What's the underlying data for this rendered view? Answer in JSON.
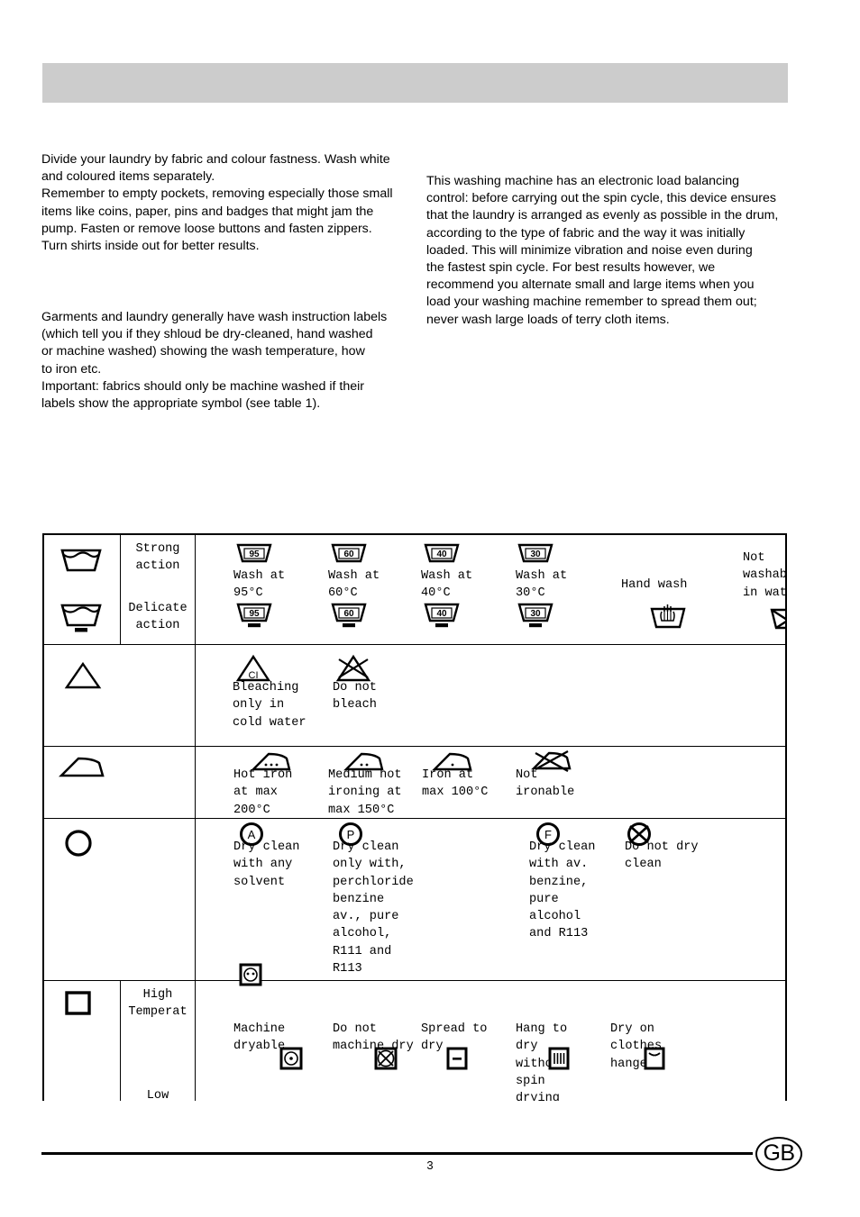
{
  "document": {
    "page_number": "3",
    "locale_badge": "GB"
  },
  "intro": {
    "left_block_1": [
      "Divide your laundry by fabric and colour fastness. Wash white",
      "and coloured items separately.",
      "Remember to empty pockets, removing especially those small",
      "items like coins, paper, pins and badges that might jam the",
      "pump. Fasten or remove loose buttons and fasten zippers.",
      "Turn shirts inside out for better results."
    ],
    "left_block_2": [
      "Garments and laundry generally have wash instruction labels",
      "(which tell you if they shloud be dry-cleaned, hand washed",
      "or machine washed) showing the wash temperature, how",
      "to iron etc.",
      "Important: fabrics should only be machine washed if their",
      "labels show the appropriate symbol (see table 1)."
    ],
    "right_block": [
      "This washing machine has an electronic load balancing",
      "control: before carrying out the spin cycle, this device ensures",
      "that the laundry is arranged as evenly as possible in the drum,",
      "according to the type of fabric and the way it was initially",
      "loaded. This will minimize vibration and noise even during",
      "the fastest spin cycle. For best results however, we",
      "recommend you alternate small and large items when you",
      "load your washing machine remember to spread them out;",
      "never wash large loads of terry cloth items."
    ]
  },
  "table": {
    "rows": {
      "washing": {
        "icon_name": "washtub-icon",
        "labels": {
          "strong": "Strong\naction",
          "delicate": "Delicate\naction"
        },
        "entries": [
          {
            "text": "Wash at\n95°C",
            "temp": "95",
            "icon": "washtub-95-icon"
          },
          {
            "text": "Wash at\n60°C",
            "temp": "60",
            "icon": "washtub-60-icon"
          },
          {
            "text": "Wash at\n40°C",
            "temp": "40",
            "icon": "washtub-40-icon"
          },
          {
            "text": "Wash at\n30°C",
            "temp": "30",
            "icon": "washtub-30-icon"
          },
          {
            "text": "Hand wash",
            "temp": "",
            "icon": "hand-wash-icon"
          },
          {
            "text": "Not\nwashable\nin water",
            "temp": "",
            "icon": "no-wash-icon"
          }
        ]
      },
      "bleaching": {
        "icon_name": "triangle-icon",
        "entries": [
          {
            "text": "Bleaching\nonly in\ncold water",
            "icon": "bleach-cl-icon"
          },
          {
            "text": "Do not\nbleach",
            "icon": "no-bleach-icon"
          }
        ]
      },
      "ironing": {
        "icon_name": "iron-icon",
        "entries": [
          {
            "text": "Hot iron\nat max\n200°C",
            "icon": "iron-3dot-icon"
          },
          {
            "text": "Medium hot\nironing at\nmax 150°C",
            "icon": "iron-2dot-icon"
          },
          {
            "text": "Iron at\nmax 100°C",
            "icon": "iron-1dot-icon"
          },
          {
            "text": "Not\nironable",
            "icon": "no-iron-icon"
          }
        ]
      },
      "drycleaning": {
        "icon_name": "circle-icon",
        "entries": [
          {
            "text": "Dry clean\nwith any\nsolvent",
            "icon": "circle-a-icon"
          },
          {
            "text": "Dry clean\nonly with,\nperchloride\nbenzine\nav., pure\nalcohol,\nR111 and\nR113",
            "icon": "circle-p-icon"
          },
          {
            "text": "Dry clean\nwith av.\nbenzine,\npure\nalcohol\nand R113",
            "icon": "circle-f-icon"
          },
          {
            "text": "Do not dry\nclean",
            "icon": "no-dryclean-icon"
          }
        ]
      },
      "drying": {
        "icon_name": "square-icon",
        "labels": {
          "high": "High\nTemperat",
          "low": "Low"
        },
        "entries": [
          {
            "text": "Machine\ndryable",
            "icon": "tumble-dry-icon"
          },
          {
            "text": "Do not\nmachine dry",
            "icon": "no-tumble-dry-icon"
          },
          {
            "text": "Spread to\ndry",
            "icon": "flat-dry-icon"
          },
          {
            "text": "Hang to\ndry\nwithout\nspin\ndrying",
            "icon": "drip-dry-icon"
          },
          {
            "text": "Dry on\nclothes\nhanger",
            "icon": "line-dry-icon"
          }
        ]
      }
    }
  },
  "colors": {
    "header_bar": "#cccccc",
    "rule": "#000000",
    "text": "#000000"
  }
}
